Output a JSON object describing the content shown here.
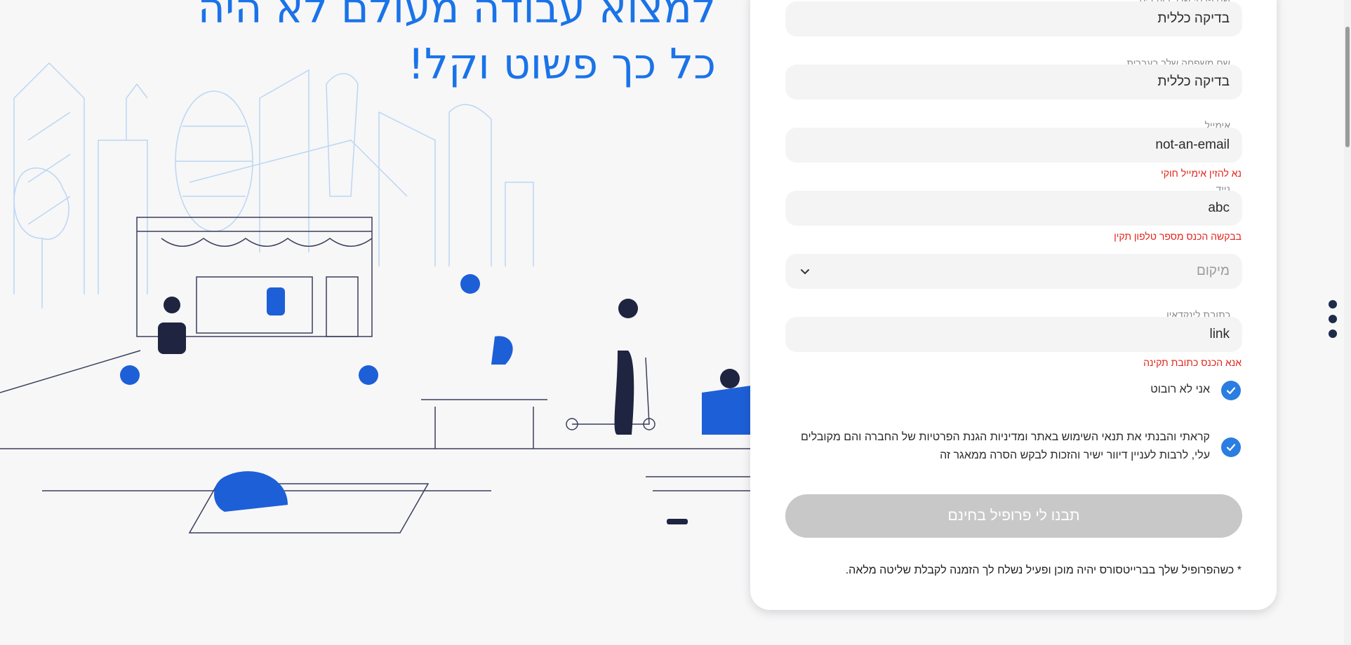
{
  "hero": {
    "line1": "למצוא עבודה מעולם לא היה",
    "line2": "כל כך פשוט וקל!"
  },
  "form": {
    "first_name": {
      "label": "שם פרטי שלך בעברית",
      "value": "בדיקה כללית"
    },
    "last_name": {
      "label": "שם משפחה שלך בעברית",
      "value": "בדיקה כללית"
    },
    "email": {
      "label": "אימייל",
      "value": "not-an-email",
      "error": "נא להזין אימייל חוקי"
    },
    "phone": {
      "label": "נייד",
      "value": "abc",
      "error": "בבקשה הכנס מספר טלפון תקין"
    },
    "location": {
      "placeholder": "מיקום"
    },
    "linkedin": {
      "label": "כתובת לינקדאין",
      "value": "link",
      "error": "אנא הכנס כתובת תקינה"
    },
    "robot_check": {
      "label": "אני לא רובוט",
      "checked": true
    },
    "terms": {
      "line1": "קראתי והבנתי את תנאי השימוש באתר ומדיניות הגנת הפרטיות של החברה והם מקובלים",
      "line2": "עלי, לרבות לעניין דיוור ישיר והזכות לבקש הסרה ממאגר זה",
      "checked": true
    },
    "submit_label": "תבנו לי פרופיל בחינם",
    "footnote": "* כשהפרופיל שלך בברייטסורס יהיה מוכן ופעיל נשלח לך הזמנה לקבלת שליטה מלאה."
  },
  "colors": {
    "brand_blue": "#1a73e8",
    "check_blue": "#2a7de1",
    "error_red": "#e2231a",
    "disabled_button": "#c8c8c8"
  },
  "icons": [
    "chevron-down-icon",
    "checkmark-icon",
    "pagination-dot-icon"
  ]
}
